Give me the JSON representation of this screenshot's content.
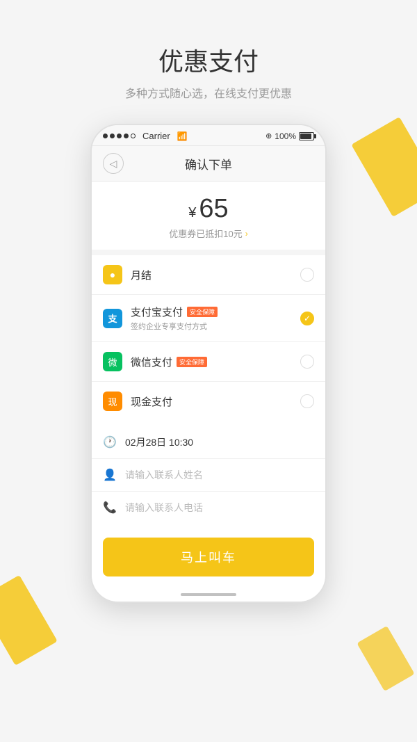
{
  "page": {
    "background_color": "#f5f5f5"
  },
  "header": {
    "title": "优惠支付",
    "subtitle": "多种方式随心选，在线支付更优惠"
  },
  "phone": {
    "status_bar": {
      "signal_dots": 4,
      "carrier": "Carrier",
      "wifi_symbol": "WiFi",
      "location_icon": "⊕",
      "battery_percent": "100%",
      "battery_label": "100%"
    },
    "nav": {
      "back_icon": "←",
      "title": "确认下单"
    },
    "price_section": {
      "currency": "¥",
      "amount": "65",
      "discount_text": "优惠券已抵扣10元",
      "discount_arrow": ">"
    },
    "payment_methods": [
      {
        "id": "monthly",
        "icon": "●",
        "icon_color": "#f5c518",
        "name": "月结",
        "sub": "",
        "badge": "",
        "selected": false
      },
      {
        "id": "alipay",
        "icon": "支",
        "icon_color": "#1296db",
        "name": "支付宝支付",
        "badge": "安全保障",
        "sub": "签约企业专享支付方式",
        "selected": true
      },
      {
        "id": "wechat",
        "icon": "微",
        "icon_color": "#07c160",
        "name": "微信支付",
        "badge": "安全保障",
        "sub": "",
        "selected": false
      },
      {
        "id": "cash",
        "icon": "现",
        "icon_color": "#ff8c00",
        "name": "现金支付",
        "sub": "",
        "badge": "",
        "selected": false
      }
    ],
    "form_fields": [
      {
        "id": "datetime",
        "icon": "🕐",
        "value": "02月28日 10:30",
        "placeholder": "",
        "is_placeholder": false
      },
      {
        "id": "contact_name",
        "icon": "👤",
        "value": "",
        "placeholder": "请输入联系人姓名",
        "is_placeholder": true
      },
      {
        "id": "contact_phone",
        "icon": "📞",
        "value": "",
        "placeholder": "请输入联系人电话",
        "is_placeholder": true
      }
    ],
    "submit_button": {
      "label": "马上叫车"
    }
  }
}
